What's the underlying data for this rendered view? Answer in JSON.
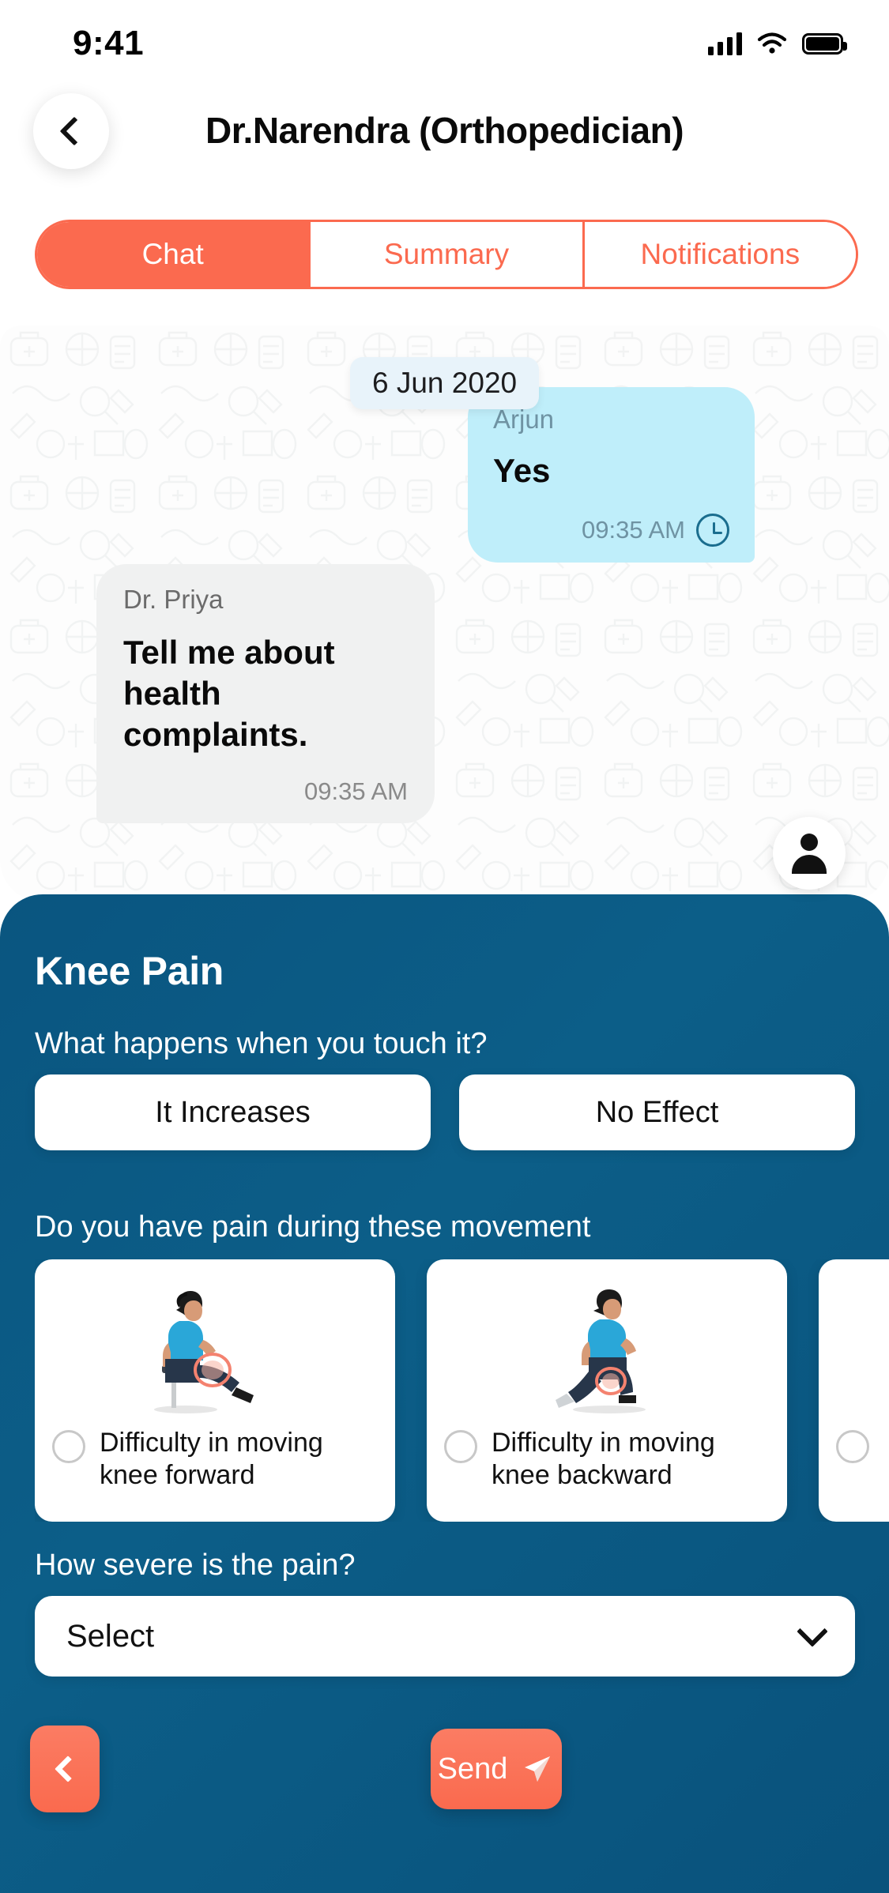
{
  "status_bar": {
    "time": "9:41",
    "signal_icon": "cellular-signal-icon",
    "wifi_icon": "wifi-icon",
    "battery_icon": "battery-full-icon"
  },
  "header": {
    "back_icon": "chevron-left-icon",
    "title": "Dr.Narendra (Orthopedician)"
  },
  "tabs": [
    {
      "label": "Chat",
      "active": true
    },
    {
      "label": "Summary",
      "active": false
    },
    {
      "label": "Notifications",
      "active": false
    }
  ],
  "chat": {
    "date_divider": "6 Jun 2020",
    "messages": [
      {
        "sender": "Arjun",
        "text": "Yes",
        "time": "09:35 AM",
        "side": "right",
        "status_icon": "clock-pending-icon",
        "avatar": "user-avatar-icon"
      },
      {
        "sender": "Dr. Priya",
        "text": "Tell me about health complaints.",
        "time": "09:35 AM",
        "side": "left",
        "avatar": "doctor-photo-avatar"
      }
    ]
  },
  "form": {
    "title": "Knee Pain",
    "question_touch": "What happens when you touch it?",
    "touch_options": [
      "It Increases",
      "No Effect"
    ],
    "question_movement": "Do you have pain during these movement",
    "movement_cards": [
      {
        "label": "Difficulty in moving knee forward",
        "selected": false,
        "art": "seated-knee-extension-illustration"
      },
      {
        "label": "Difficulty in moving knee backward",
        "selected": false,
        "art": "kneeling-lunge-illustration"
      },
      {
        "label": "",
        "selected": false,
        "art": "third-card-partial"
      }
    ],
    "question_severity": "How severe is the pain?",
    "severity_value": "Select",
    "severity_caret_icon": "chevron-down-icon"
  },
  "footer": {
    "back_icon": "chevron-left-icon",
    "send_label": "Send",
    "send_icon": "paper-plane-icon"
  },
  "colors": {
    "accent_coral": "#FB6A4F",
    "panel_blue": "#0A5580",
    "bubble_incoming": "#F0F1F1",
    "bubble_outgoing": "#BFEEFA",
    "date_chip": "#E8F3FA"
  }
}
